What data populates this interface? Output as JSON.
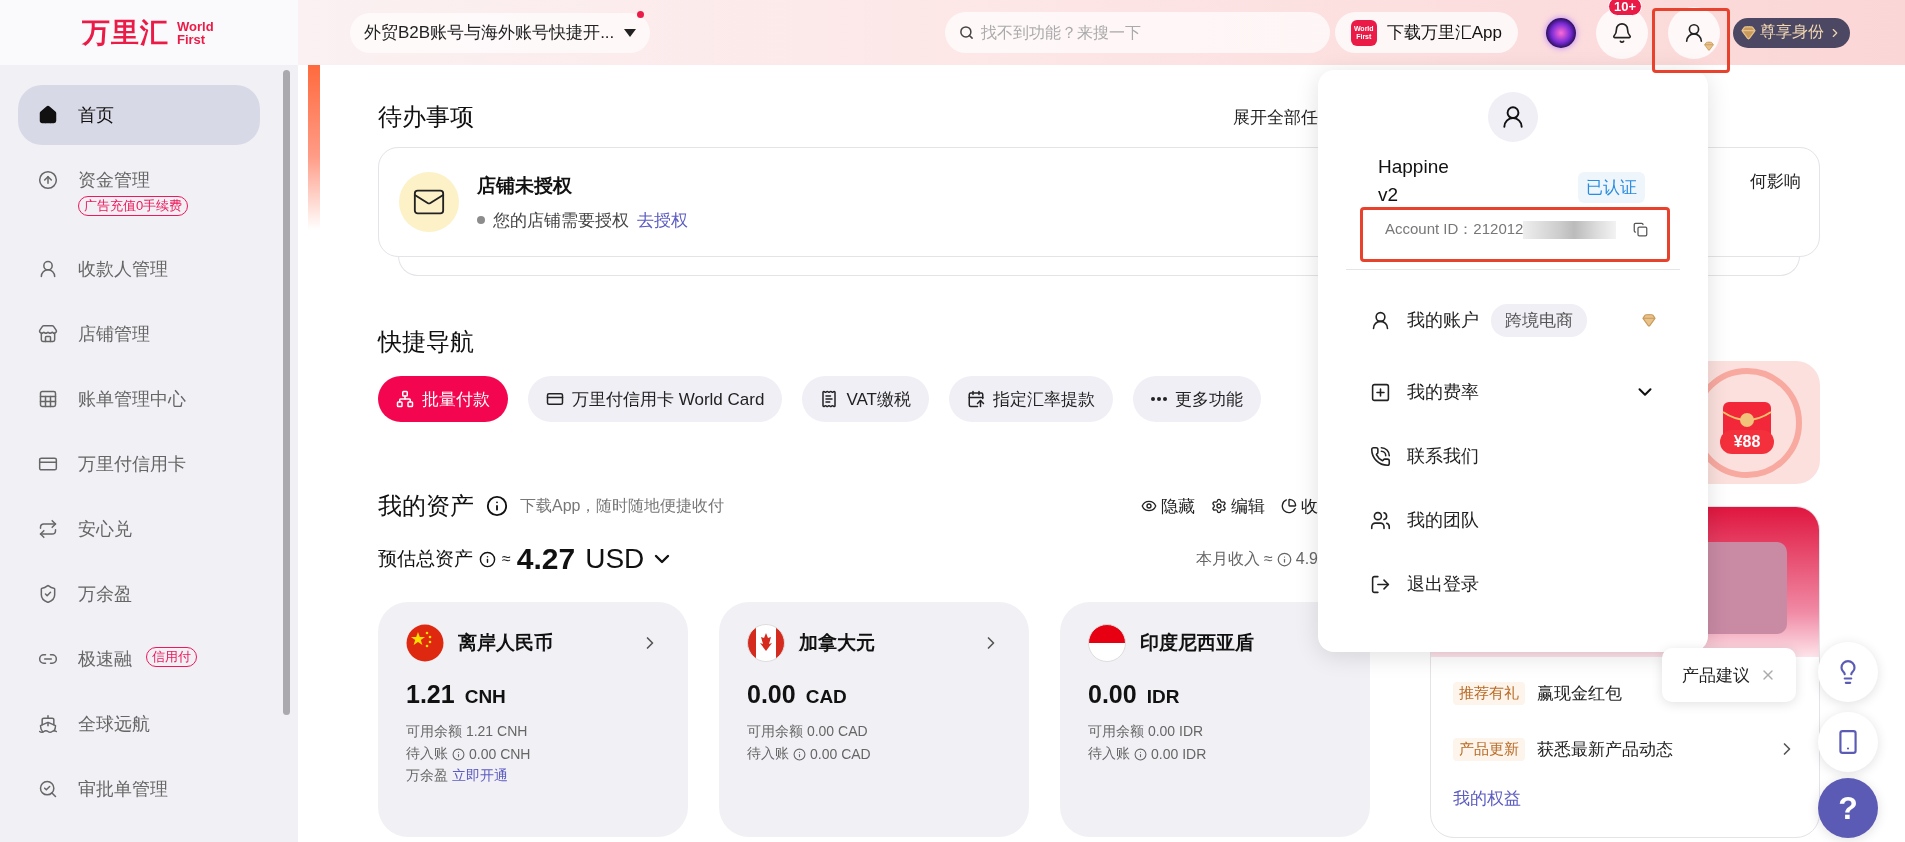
{
  "logo": {
    "name": "万里汇",
    "sub": "World First"
  },
  "sidebar": {
    "items": [
      {
        "kind": "plain",
        "label": "首页",
        "selected": true
      },
      {
        "kind": "tag-below",
        "label": "资金管理",
        "selected": false,
        "badge": "广告充值0手续费"
      },
      {
        "kind": "plain",
        "label": "收款人管理",
        "selected": false
      },
      {
        "kind": "plain",
        "label": "店铺管理",
        "selected": false
      },
      {
        "kind": "plain",
        "label": "账单管理中心",
        "selected": false
      },
      {
        "kind": "plain",
        "label": "万里付信用卡",
        "selected": false
      },
      {
        "kind": "plain",
        "label": "安心兑",
        "selected": false
      },
      {
        "kind": "plain",
        "label": "万余盈",
        "selected": false
      },
      {
        "kind": "tag-inline",
        "label": "极速融",
        "selected": false,
        "badge": "信用付"
      },
      {
        "kind": "plain",
        "label": "全球远航",
        "selected": false
      },
      {
        "kind": "plain",
        "label": "审批单管理",
        "selected": false
      }
    ]
  },
  "top_bar": {
    "account_switch": "外贸B2B账号与海外账号快捷开...",
    "search": {
      "placeholder": "找不到功能？来搜一下"
    },
    "app_button": {
      "logo": "World First",
      "label": "下载万里汇App"
    },
    "notifications": {
      "count": "10+"
    },
    "vip": "尊享身份"
  },
  "todo": {
    "title": "待办事项",
    "expand": "展开全部任",
    "card": {
      "title": "店铺未授权",
      "status": "您的店铺需要授权",
      "action": "去授权",
      "note": "何影响"
    }
  },
  "quick_nav": {
    "title": "快捷导航",
    "items": [
      {
        "label": "批量付款",
        "selected": true
      },
      {
        "label": "万里付信用卡 World Card",
        "selected": false
      },
      {
        "label": "VAT缴税",
        "selected": false
      },
      {
        "label": "指定汇率提款",
        "selected": false
      },
      {
        "label": "更多功能",
        "selected": false
      }
    ]
  },
  "assets": {
    "title": "我的资产",
    "hint": "下载App，随时随地便捷收付",
    "actions": [
      "隐藏",
      "编辑",
      "收"
    ],
    "total_label": "预估总资产",
    "approx": "≈",
    "total_value": "4.27",
    "total_currency": "USD",
    "month_label": "本月收入 ≈",
    "month_value": "4.9",
    "currencies": [
      {
        "name": "离岸人民币",
        "amount": "1.21",
        "code": "CNH",
        "available": "可用余额 1.21 CNH",
        "pending_label": "待入账",
        "pending": "0.00 CNH",
        "extra_label": "万余盈",
        "extra_link": "立即开通"
      },
      {
        "name": "加拿大元",
        "amount": "0.00",
        "code": "CAD",
        "available": "可用余额 0.00 CAD",
        "pending_label": "待入账",
        "pending": "0.00 CAD"
      },
      {
        "name": "印度尼西亚盾",
        "amount": "0.00",
        "code": "IDR",
        "available": "可用余额 0.00 IDR",
        "pending_label": "待入账",
        "pending": "0.00 IDR"
      }
    ]
  },
  "promo": {
    "amount": "¥88"
  },
  "benefits": {
    "rows": [
      {
        "tag": "推荐有礼",
        "text": "赢现金红包"
      },
      {
        "tag": "产品更新",
        "text": "获悉最新产品动态"
      }
    ],
    "link": "我的权益"
  },
  "floating": {
    "tooltip": "产品建议",
    "help": "?"
  },
  "account_menu": {
    "name_lines": [
      "Happine",
      "v2"
    ],
    "verified": "已认证",
    "account_id": "Account ID：212012",
    "items": [
      {
        "label": "我的账户",
        "tag": "跨境电商"
      },
      {
        "label": "我的费率",
        "expanded": false
      },
      {
        "label": "联系我们"
      },
      {
        "label": "我的团队"
      },
      {
        "label": "退出登录"
      }
    ]
  }
}
